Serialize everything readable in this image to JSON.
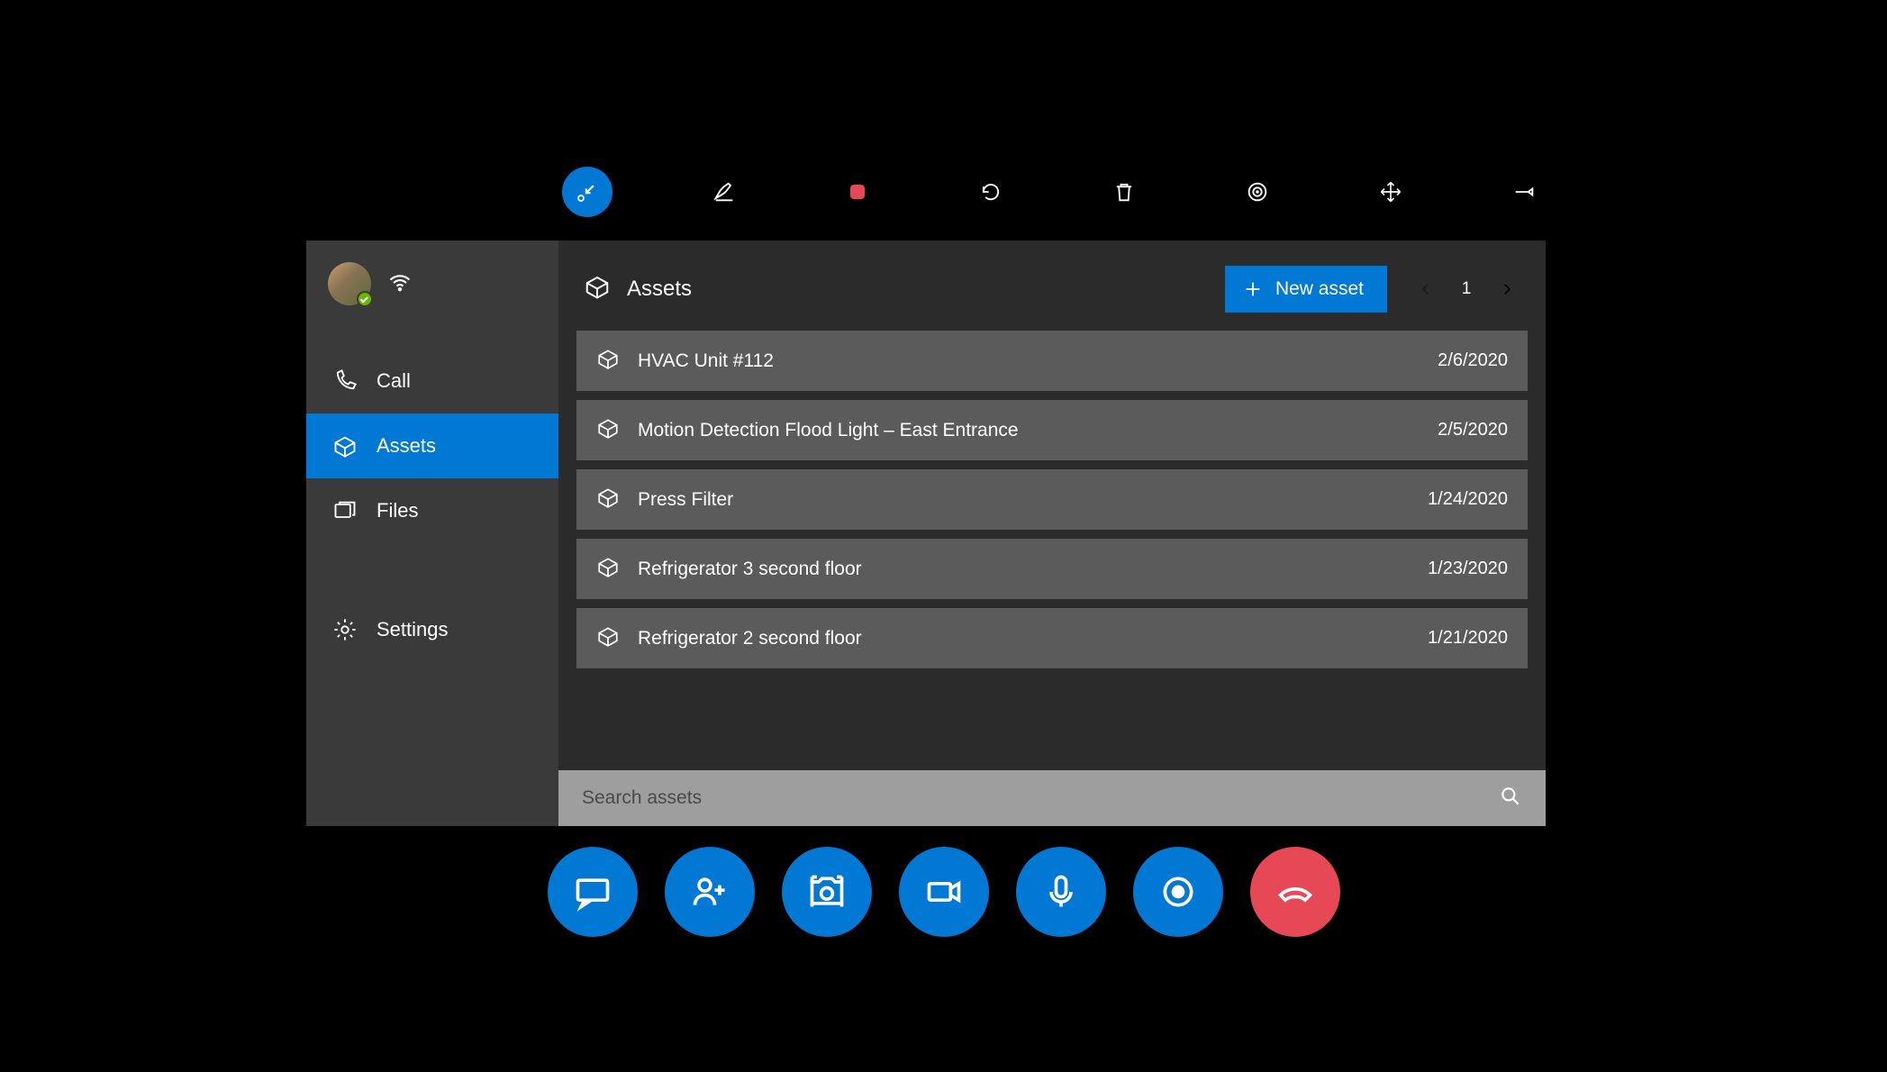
{
  "colors": {
    "accent": "#0078d4",
    "end_call": "#e74856",
    "row_bg": "#5b5b5b",
    "panel_bg": "#2b2b2b",
    "sidebar_bg": "#3a3a3a"
  },
  "top_toolbar": {
    "items": [
      "minimize",
      "pen",
      "stop",
      "undo",
      "delete",
      "target",
      "move",
      "pin"
    ]
  },
  "sidebar": {
    "items": [
      {
        "id": "call",
        "label": "Call"
      },
      {
        "id": "assets",
        "label": "Assets"
      },
      {
        "id": "files",
        "label": "Files"
      },
      {
        "id": "settings",
        "label": "Settings"
      }
    ],
    "active": "assets"
  },
  "main": {
    "title": "Assets",
    "new_asset_label": "New asset",
    "page_number": "1",
    "assets": [
      {
        "name": "HVAC Unit #112",
        "date": "2/6/2020"
      },
      {
        "name": "Motion Detection Flood Light – East Entrance",
        "date": "2/5/2020"
      },
      {
        "name": "Press Filter",
        "date": "1/24/2020"
      },
      {
        "name": "Refrigerator 3 second floor",
        "date": "1/23/2020"
      },
      {
        "name": "Refrigerator 2 second floor",
        "date": "1/21/2020"
      }
    ],
    "search_placeholder": "Search assets"
  },
  "call_bar": {
    "items": [
      "chat",
      "participants",
      "camera",
      "video",
      "mic",
      "record",
      "end"
    ]
  }
}
